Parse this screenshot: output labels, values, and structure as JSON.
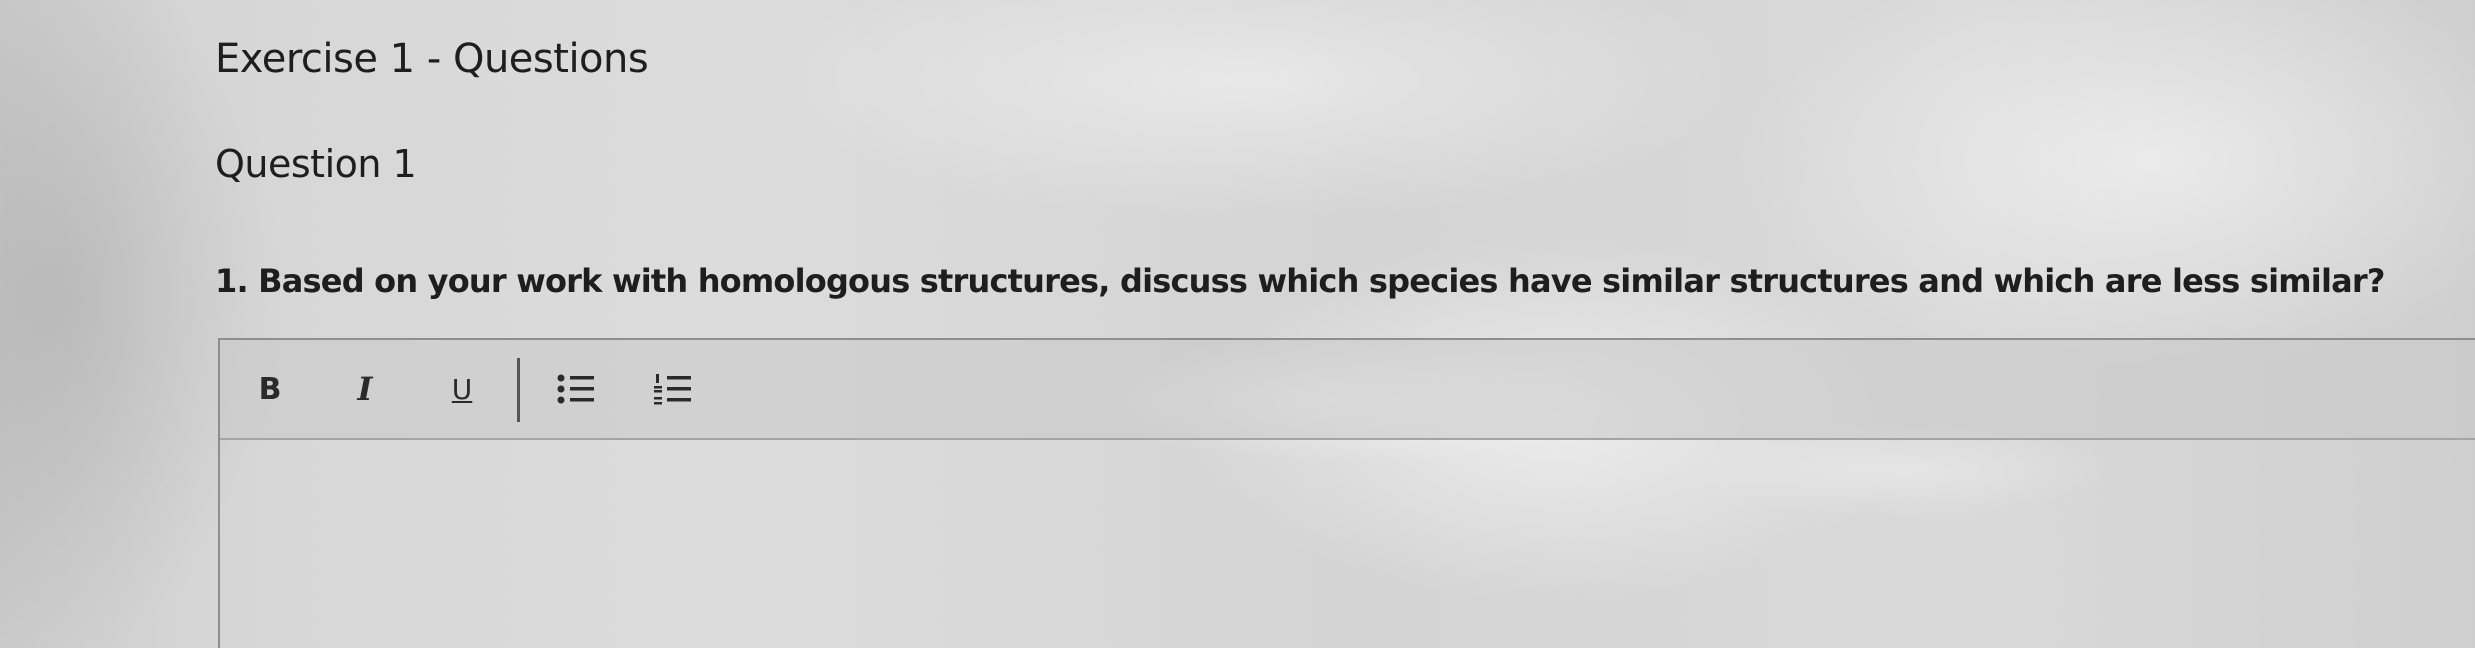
{
  "page": {
    "title": "Exercise 1 - Questions"
  },
  "question": {
    "heading": "Question 1",
    "text": "1. Based on your work with homologous structures, discuss which species have similar structures and which are less similar?"
  },
  "editor": {
    "toolbar": {
      "bold_label": "B",
      "italic_label": "I",
      "underline_label": "U",
      "bullet_list_icon": "bulleted-list-icon",
      "numbered_list_icon": "numbered-list-icon"
    },
    "answer_value": ""
  }
}
